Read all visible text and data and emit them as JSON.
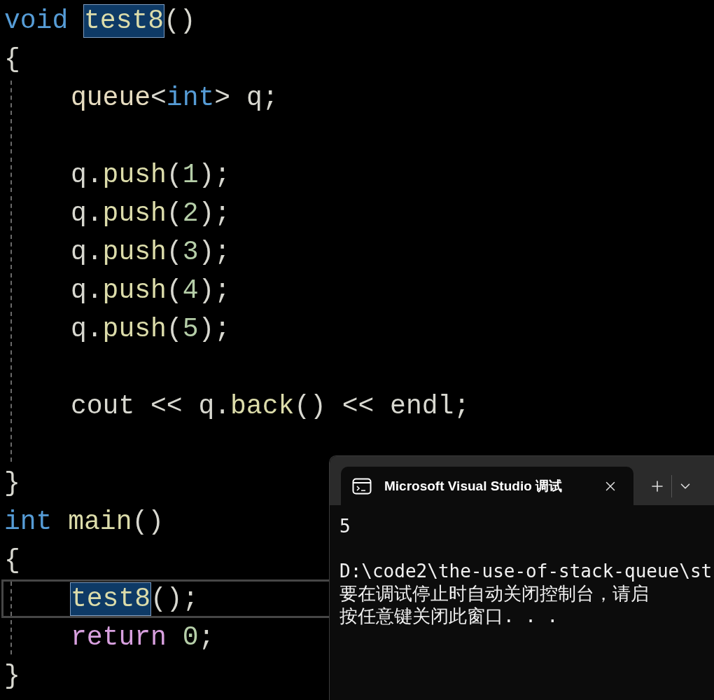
{
  "editor": {
    "lines": [
      {
        "indented": false,
        "current": false,
        "tokens": [
          {
            "text": "void ",
            "kind": "keyword",
            "highlighted": false
          },
          {
            "text": "test8",
            "kind": "function",
            "highlighted": true
          },
          {
            "text": "()",
            "kind": "plain",
            "highlighted": false
          }
        ]
      },
      {
        "indented": false,
        "current": false,
        "tokens": [
          {
            "text": "{",
            "kind": "plain",
            "highlighted": false
          }
        ]
      },
      {
        "indented": true,
        "current": false,
        "tokens": [
          {
            "text": "queue",
            "kind": "type",
            "highlighted": false
          },
          {
            "text": "<",
            "kind": "plain",
            "highlighted": false
          },
          {
            "text": "int",
            "kind": "keyword",
            "highlighted": false
          },
          {
            "text": ">",
            "kind": "plain",
            "highlighted": false
          },
          {
            "text": " q;",
            "kind": "plain",
            "highlighted": false
          }
        ]
      },
      {
        "indented": true,
        "current": false
      },
      {
        "indented": true,
        "current": false,
        "tokens": [
          {
            "text": "q.",
            "kind": "plain",
            "highlighted": false
          },
          {
            "text": "push",
            "kind": "function",
            "highlighted": false
          },
          {
            "text": "(",
            "kind": "plain",
            "highlighted": false
          },
          {
            "text": "1",
            "kind": "number",
            "highlighted": false
          },
          {
            "text": ");",
            "kind": "plain",
            "highlighted": false
          }
        ]
      },
      {
        "indented": true,
        "current": false,
        "tokens": [
          {
            "text": "q.",
            "kind": "plain",
            "highlighted": false
          },
          {
            "text": "push",
            "kind": "function",
            "highlighted": false
          },
          {
            "text": "(",
            "kind": "plain",
            "highlighted": false
          },
          {
            "text": "2",
            "kind": "number",
            "highlighted": false
          },
          {
            "text": ");",
            "kind": "plain",
            "highlighted": false
          }
        ]
      },
      {
        "indented": true,
        "current": false,
        "tokens": [
          {
            "text": "q.",
            "kind": "plain",
            "highlighted": false
          },
          {
            "text": "push",
            "kind": "function",
            "highlighted": false
          },
          {
            "text": "(",
            "kind": "plain",
            "highlighted": false
          },
          {
            "text": "3",
            "kind": "number",
            "highlighted": false
          },
          {
            "text": ");",
            "kind": "plain",
            "highlighted": false
          }
        ]
      },
      {
        "indented": true,
        "current": false,
        "tokens": [
          {
            "text": "q.",
            "kind": "plain",
            "highlighted": false
          },
          {
            "text": "push",
            "kind": "function",
            "highlighted": false
          },
          {
            "text": "(",
            "kind": "plain",
            "highlighted": false
          },
          {
            "text": "4",
            "kind": "number",
            "highlighted": false
          },
          {
            "text": ");",
            "kind": "plain",
            "highlighted": false
          }
        ]
      },
      {
        "indented": true,
        "current": false,
        "tokens": [
          {
            "text": "q.",
            "kind": "plain",
            "highlighted": false
          },
          {
            "text": "push",
            "kind": "function",
            "highlighted": false
          },
          {
            "text": "(",
            "kind": "plain",
            "highlighted": false
          },
          {
            "text": "5",
            "kind": "number",
            "highlighted": false
          },
          {
            "text": ");",
            "kind": "plain",
            "highlighted": false
          }
        ]
      },
      {
        "indented": true,
        "current": false
      },
      {
        "indented": true,
        "current": false,
        "tokens": [
          {
            "text": "cout << q.",
            "kind": "plain",
            "highlighted": false
          },
          {
            "text": "back",
            "kind": "function",
            "highlighted": false
          },
          {
            "text": "() << endl;",
            "kind": "plain",
            "highlighted": false
          }
        ]
      },
      {
        "indented": true,
        "current": false
      },
      {
        "indented": false,
        "current": false,
        "tokens": [
          {
            "text": "}",
            "kind": "plain",
            "highlighted": false
          }
        ]
      },
      {
        "indented": false,
        "current": false,
        "tokens": [
          {
            "text": "int ",
            "kind": "keyword",
            "highlighted": false
          },
          {
            "text": "main",
            "kind": "function",
            "highlighted": false
          },
          {
            "text": "()",
            "kind": "plain",
            "highlighted": false
          }
        ]
      },
      {
        "indented": false,
        "current": false,
        "tokens": [
          {
            "text": "{",
            "kind": "plain",
            "highlighted": false
          }
        ]
      },
      {
        "indented": true,
        "current": true,
        "tokens": [
          {
            "text": "test8",
            "kind": "function",
            "highlighted": true
          },
          {
            "text": "();",
            "kind": "plain",
            "highlighted": false
          }
        ]
      },
      {
        "indented": true,
        "current": false,
        "tokens": [
          {
            "text": "return ",
            "kind": "control",
            "highlighted": false
          },
          {
            "text": "0",
            "kind": "number",
            "highlighted": false
          },
          {
            "text": ";",
            "kind": "plain",
            "highlighted": false
          }
        ]
      },
      {
        "indented": false,
        "current": false,
        "tokens": [
          {
            "text": "}",
            "kind": "plain",
            "highlighted": false
          }
        ]
      }
    ]
  },
  "console": {
    "tab": {
      "title": "Microsoft Visual Studio 调试",
      "selected": true
    },
    "output_blocks": [
      {
        "lines": [
          "5"
        ]
      },
      {
        "lines": [
          "D:\\code2\\the-use-of-stack-queue\\st",
          "要在调试停止时自动关闭控制台，请启",
          "按任意键关闭此窗口. . ."
        ]
      }
    ]
  }
}
